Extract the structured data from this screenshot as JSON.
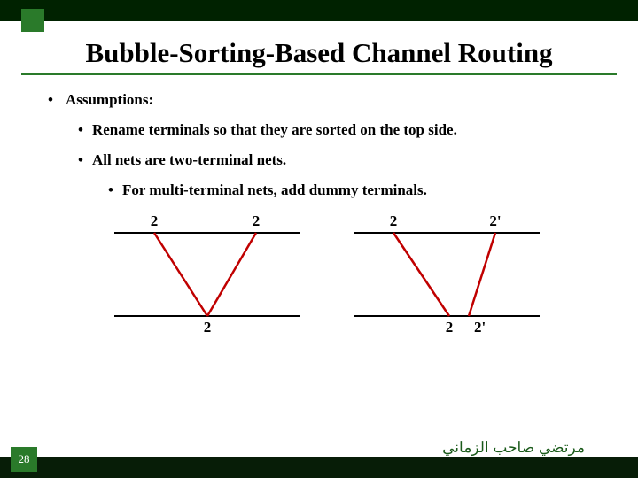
{
  "title": "Bubble-Sorting-Based Channel Routing",
  "bullets": {
    "l1": "Assumptions:",
    "l2a": "Rename terminals so that they are sorted on the top side.",
    "l2b": "All nets are two-terminal nets.",
    "l3": "For multi-terminal nets, add dummy terminals."
  },
  "diagram": {
    "left": {
      "t1": "2",
      "t2": "2",
      "b1": "2"
    },
    "right": {
      "t1": "2",
      "t2": "2'",
      "b1": "2",
      "b2": "2'"
    }
  },
  "page_number": "28",
  "author": "مرتضي صاحب الزماني"
}
